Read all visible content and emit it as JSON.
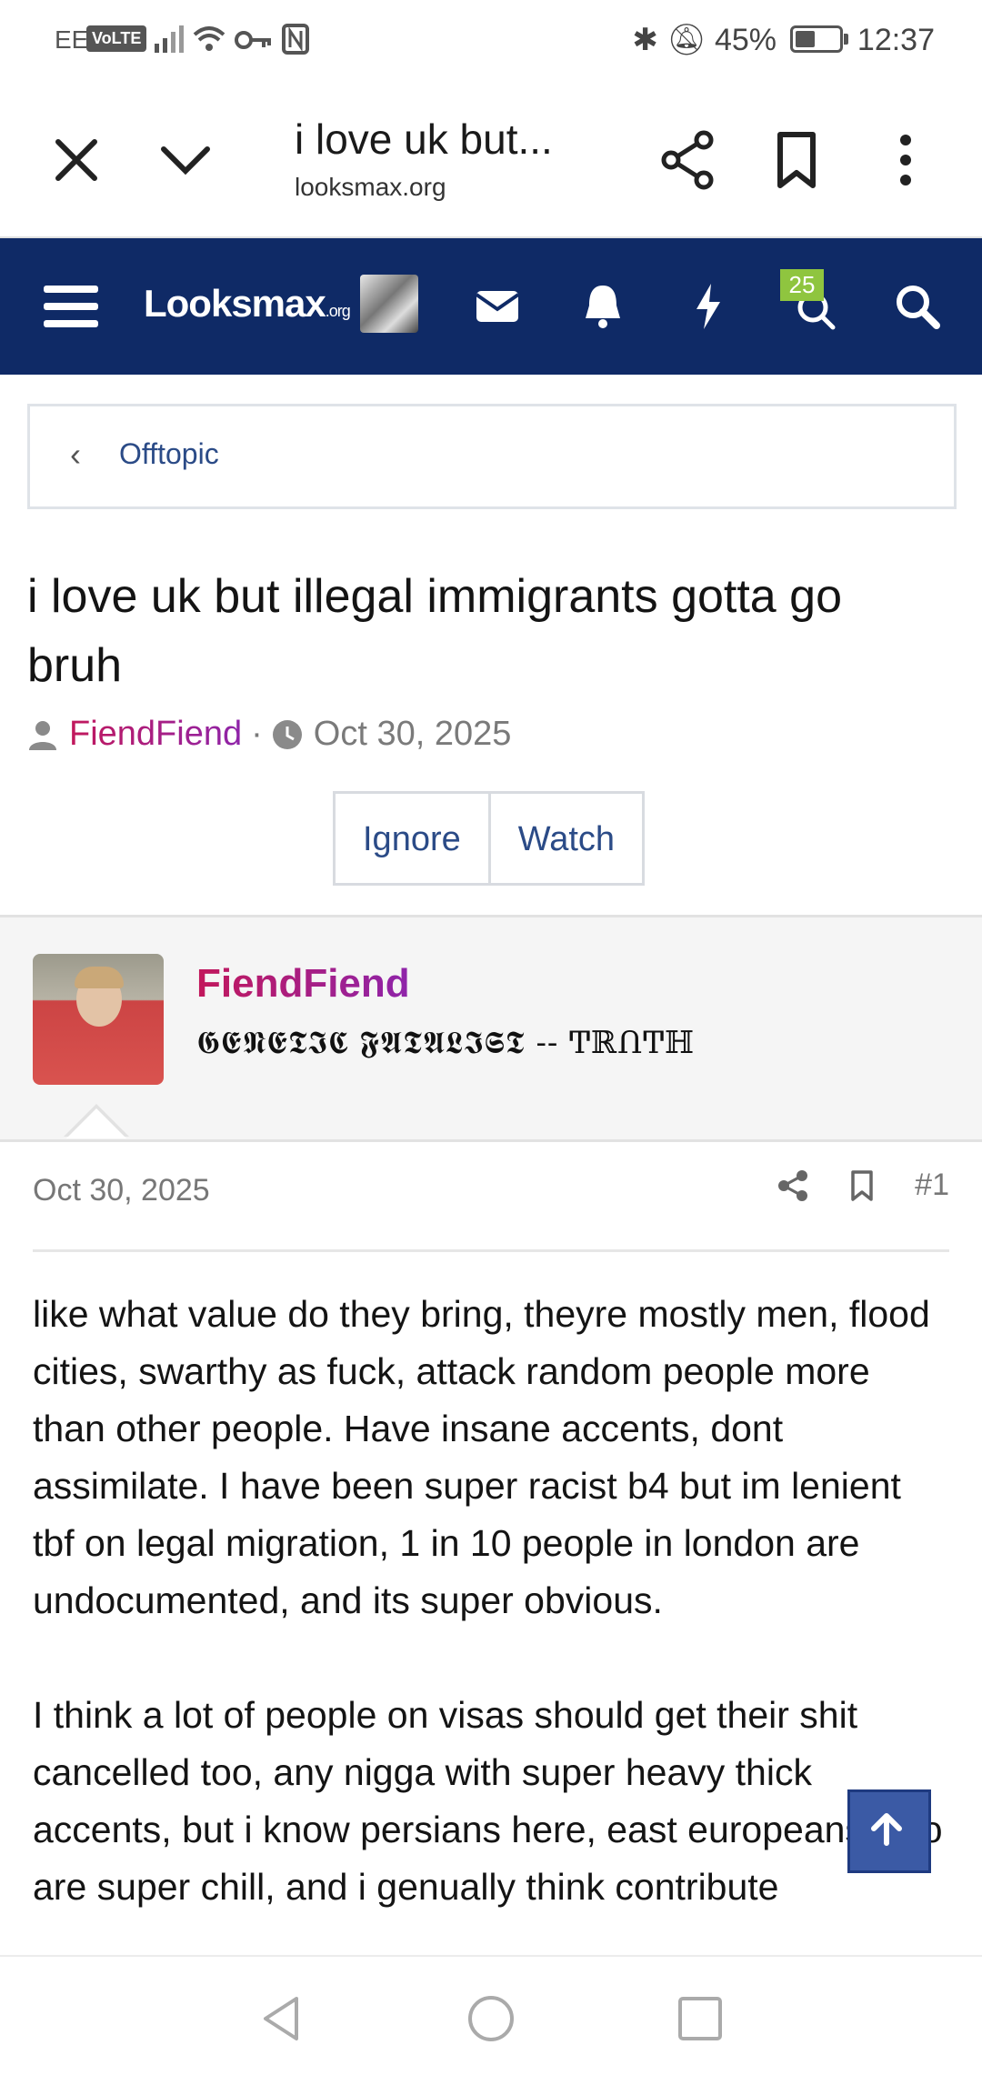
{
  "status_bar": {
    "carrier": "EE",
    "volte": "VoLTE",
    "battery": "45%",
    "time": "12:37"
  },
  "browser": {
    "title": "i love uk but...",
    "url": "looksmax.org"
  },
  "site_nav": {
    "logo": "Looksmax",
    "logo_suffix": ".org",
    "badge_count": "25"
  },
  "breadcrumb": {
    "label": "Offtopic"
  },
  "thread": {
    "title": "i love uk but illegal immigrants gotta go bruh",
    "author": "FiendFiend",
    "separator": "·",
    "date": "Oct 30, 2025",
    "ignore_label": "Ignore",
    "watch_label": "Watch"
  },
  "post": {
    "username": "FiendFiend",
    "user_title": "𝕲𝕰𝕹𝕰𝕿𝕴𝕮 𝕱𝕬𝕿𝕬𝕷𝕴𝕾𝕿 -- ͲℝՈͲℍ",
    "date": "Oct 30, 2025",
    "number": "#1",
    "paragraph_1": "like what value do they bring, theyre mostly men, flood cities, swarthy as fuck, attack random people more than other people. Have insane accents, dont assimilate. I have been super racist b4 but im lenient tbf on legal migration, 1 in 10 people in london are undocumented, and its super obvious.",
    "paragraph_2": "I think a lot of people on visas should get their shit cancelled too, any nigga with super heavy thick accents, but i know persians here, east europeans who are super chill, and i genually think contribute"
  }
}
